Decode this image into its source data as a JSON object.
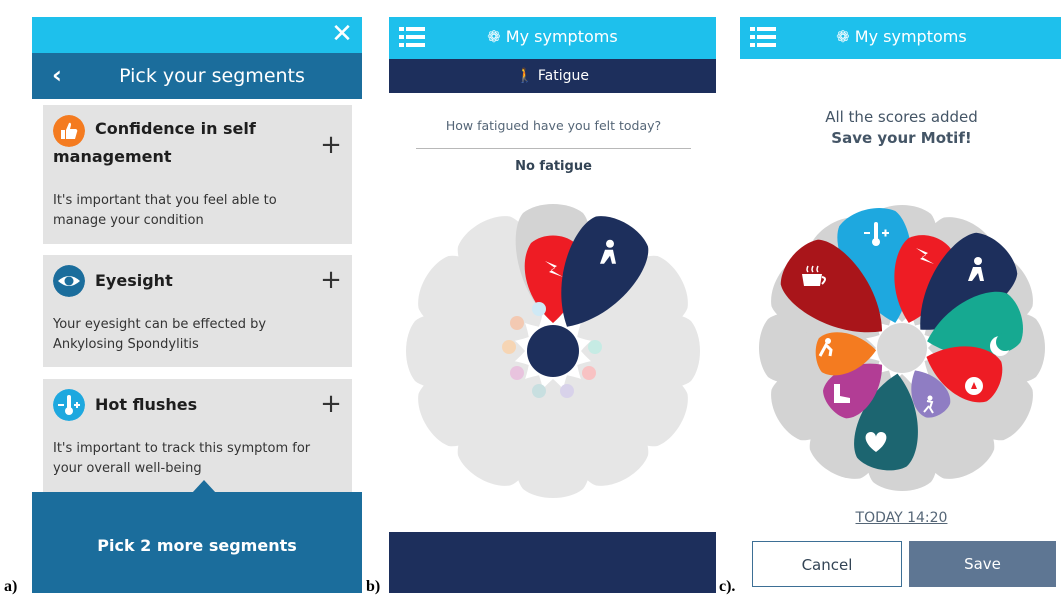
{
  "labels": {
    "a": "a)",
    "b": "b)",
    "c": "c)."
  },
  "panel_a": {
    "title": "Pick your segments",
    "close_glyph": "✕",
    "back_glyph": "‹",
    "cards": [
      {
        "title": "Confidence in self management",
        "title_line1": "Confidence in self",
        "title_line2": "management",
        "description_line1": "It's important that you feel able to",
        "description_line2": "manage your condition",
        "icon": "thumbs-up-icon",
        "icon_color": "#f47b20"
      },
      {
        "title": "Eyesight",
        "description_line1": "Your eyesight can be effected by",
        "description_line2": "Ankylosing Spondylitis",
        "icon": "eye-icon",
        "icon_color": "#1b6d9c"
      },
      {
        "title": "Hot flushes",
        "description_line1": "It's important to track this symptom for",
        "description_line2": "your overall well-being",
        "icon": "thermometer-icon",
        "icon_color": "#1ea8df"
      }
    ],
    "plus_glyph": "+",
    "footer": "Pick 2 more segments"
  },
  "panel_b": {
    "title": "My symptoms",
    "subtitle": "Fatigue",
    "question": "How fatigued have you felt today?",
    "answer": "No fatigue"
  },
  "panel_c": {
    "title": "My symptoms",
    "line1": "All the scores added",
    "line2": "Save your Motif!",
    "date": "TODAY 14:20",
    "cancel": "Cancel",
    "save": "Save"
  },
  "colors": {
    "topbar": "#1ec0ec",
    "header_dark_blue": "#1b6d9c",
    "navy": "#1d2f5c",
    "petal_grey": "#d3d3d3",
    "petal_light": "#e6e6e6",
    "red": "#ee1c24",
    "orange": "#f47b20",
    "cyan": "#1ea8df",
    "dark_red": "#a9151a",
    "teal": "#16a991",
    "magenta": "#b23d95",
    "purple_light": "#8f7dc3",
    "dark_teal": "#1c6570"
  }
}
